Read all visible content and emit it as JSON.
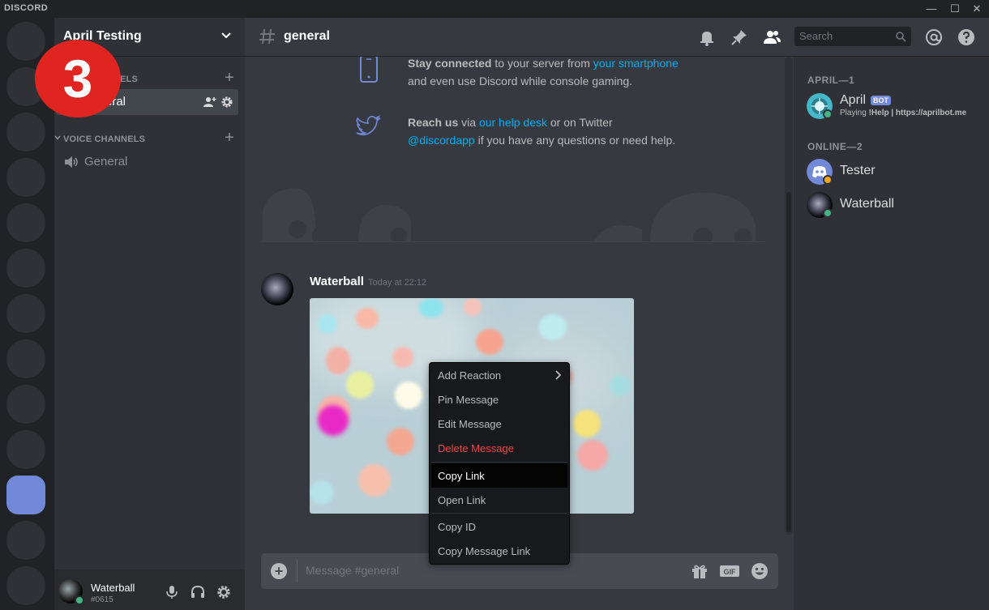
{
  "app": {
    "brand": "DISCORD",
    "window_controls": [
      "minimize",
      "maximize",
      "close"
    ]
  },
  "step_badge": "3",
  "server": {
    "name": "April Testing"
  },
  "sidebar": {
    "text_category": "TEXT CHANNELS",
    "text_category_visible": "ELS",
    "text_channel": "general",
    "text_channel_visible": "eral",
    "voice_category": "VOICE CHANNELS",
    "voice_channel": "General"
  },
  "user": {
    "name": "Waterball",
    "tag": "#0615",
    "status_color": "#43b581"
  },
  "channel_header": {
    "name": "general",
    "search_placeholder": "Search"
  },
  "welcome": {
    "row1": {
      "bold": "Stay connected",
      "t1": " to your server from ",
      "link": "your smartphone",
      "t2": "and even use Discord while console gaming."
    },
    "row2": {
      "bold": "Reach us",
      "t1": " via ",
      "link1": "our help desk",
      "t2": " or on Twitter",
      "link2": "@discordapp",
      "t3": " if you have any questions or need help."
    }
  },
  "message": {
    "author": "Waterball",
    "timestamp": "Today at 22:12"
  },
  "composer": {
    "placeholder": "Message #general"
  },
  "context_menu": {
    "items": [
      {
        "label": "Add Reaction"
      },
      {
        "label": "Pin Message"
      },
      {
        "label": "Edit Message"
      },
      {
        "label": "Delete Message"
      },
      {
        "label": "Copy Link"
      },
      {
        "label": "Open Link"
      },
      {
        "label": "Copy ID"
      },
      {
        "label": "Copy Message Link"
      }
    ]
  },
  "members": {
    "group1": "APRIL—1",
    "group2": "ONLINE—2",
    "april": {
      "name": "April",
      "badge": "BOT",
      "activity_prefix": "Playing ",
      "activity": "!Help | https://aprilbot.me",
      "status_color": "#faa61a"
    },
    "tester": {
      "name": "Tester",
      "status_color": "#faa61a"
    },
    "waterball": {
      "name": "Waterball",
      "status_color": "#43b581"
    }
  },
  "colors": {
    "accent": "#7289da",
    "link": "#00b0f4",
    "danger": "#f04747",
    "badge": "#e0241f"
  }
}
